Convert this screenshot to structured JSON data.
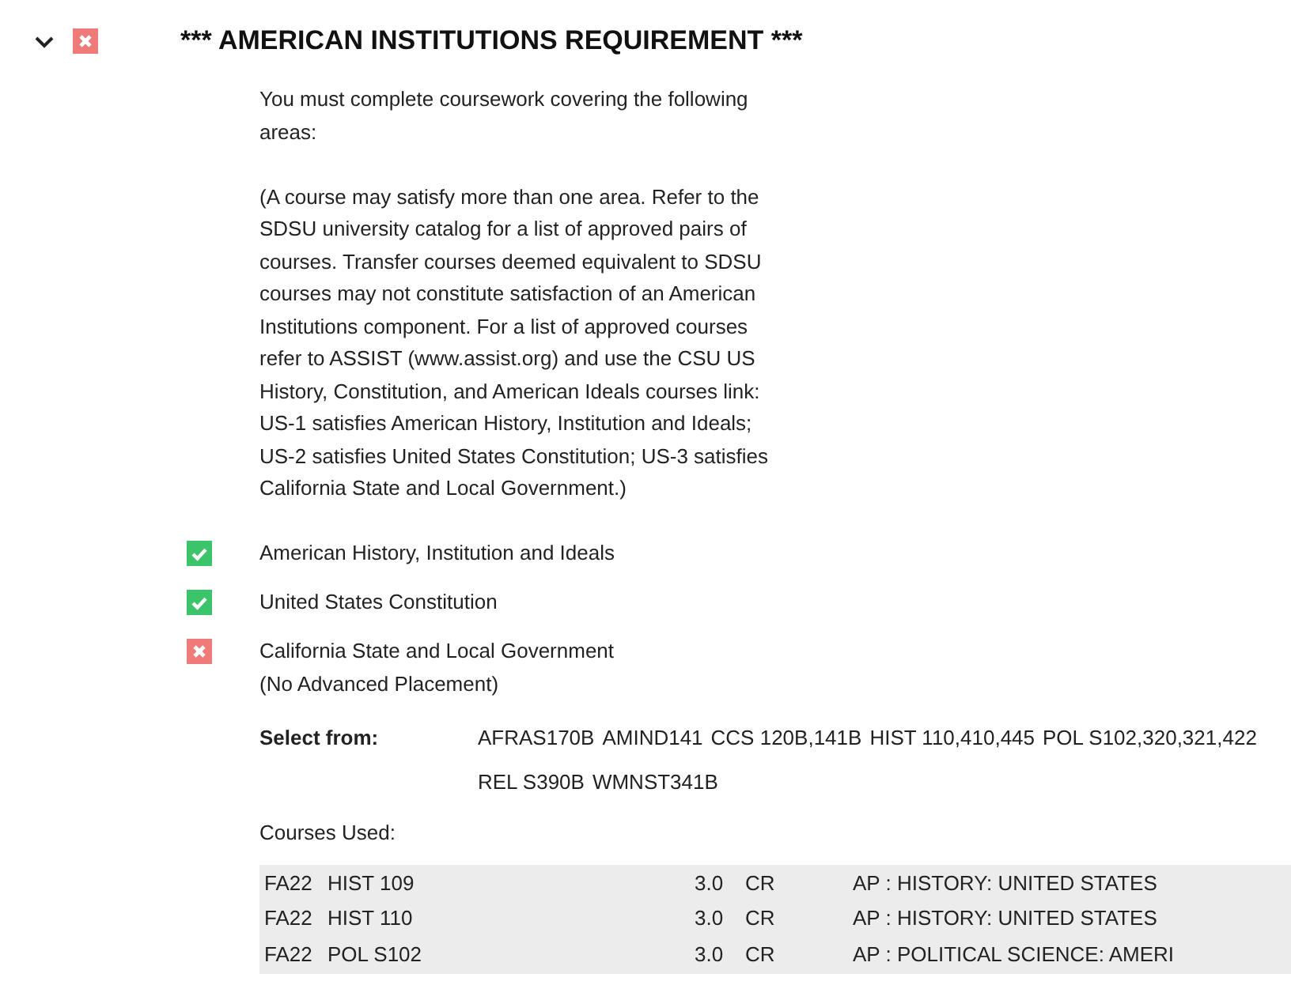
{
  "requirement": {
    "expanded": true,
    "complete": false,
    "title": "*** AMERICAN INSTITUTIONS REQUIREMENT ***",
    "paragraphs": [
      "You must complete coursework covering the following areas:",
      "(A course may satisfy more than one area. Refer to the SDSU university catalog for a list of approved pairs of courses. Transfer courses deemed equivalent to SDSU courses may not constitute satisfaction of an American Institutions component. For a list of approved courses refer to ASSIST (www.assist.org) and use the CSU US History, Constitution, and American Ideals courses link: US-1 satisfies American History, Institution and Ideals; US-2 satisfies United States Constitution; US-3 satisfies California State and Local Government.)"
    ],
    "subrequirements": [
      {
        "complete": true,
        "lines": [
          "American History, Institution and Ideals"
        ]
      },
      {
        "complete": true,
        "lines": [
          "United States Constitution"
        ]
      },
      {
        "complete": false,
        "lines": [
          "California State and Local Government",
          "(No Advanced Placement)"
        ]
      }
    ],
    "select_from": {
      "label": "Select from:",
      "courses": [
        "AFRAS170B",
        "AMIND141",
        "CCS 120B,141B",
        "HIST 110,410,445",
        "POL S102,320,321,422",
        "REL S390B",
        "WMNST341B"
      ]
    },
    "courses_used": {
      "label": "Courses Used:",
      "rows": [
        {
          "term": "FA22",
          "course": "HIST 109",
          "units": "3.0",
          "grade": "CR",
          "title": "AP : HISTORY: UNITED STATES"
        },
        {
          "term": "FA22",
          "course": "HIST 110",
          "units": "3.0",
          "grade": "CR",
          "title": "AP : HISTORY: UNITED STATES"
        },
        {
          "term": "FA22",
          "course": "POL S102",
          "units": "3.0",
          "grade": "CR",
          "title": "AP : POLITICAL SCIENCE: AMERI"
        }
      ]
    }
  }
}
